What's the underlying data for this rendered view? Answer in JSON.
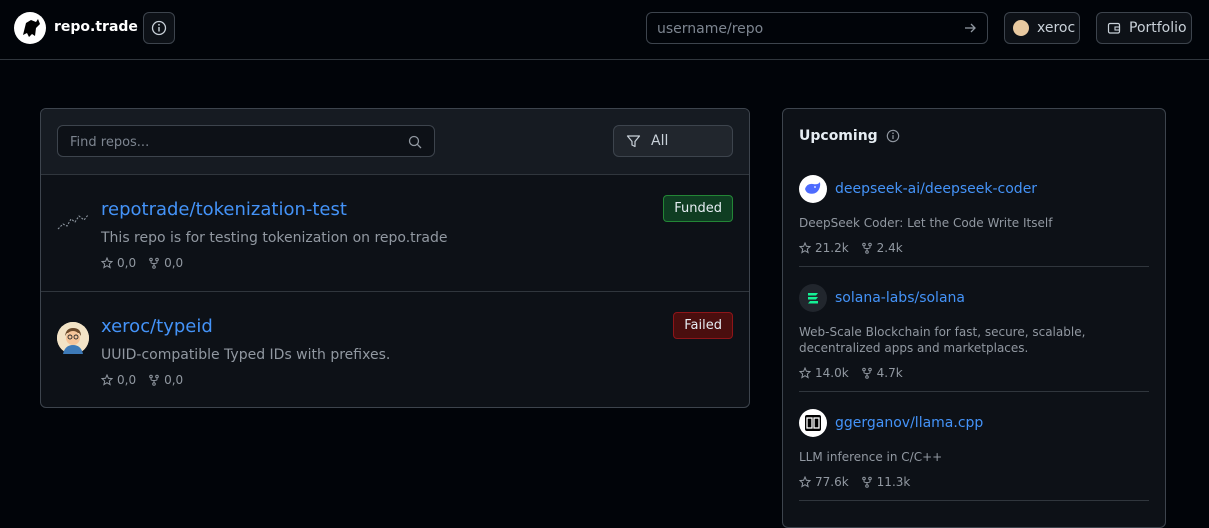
{
  "header": {
    "brand": "repo.trade",
    "search_placeholder": "username/repo",
    "user_label": "xeroc",
    "portfolio_label": "Portfolio"
  },
  "repos": {
    "search_placeholder": "Find repos...",
    "filter_label": "All",
    "items": [
      {
        "name": "repotrade/tokenization-test",
        "description": "This repo is for testing tokenization on repo.trade",
        "stars": "0,0",
        "forks": "0,0",
        "status": "Funded"
      },
      {
        "name": "xeroc/typeid",
        "description": "UUID-compatible Typed IDs with prefixes.",
        "stars": "0,0",
        "forks": "0,0",
        "status": "Failed"
      }
    ]
  },
  "upcoming": {
    "title": "Upcoming",
    "items": [
      {
        "name": "deepseek-ai/deepseek-coder",
        "description": "DeepSeek Coder: Let the Code Write Itself",
        "stars": "21.2k",
        "forks": "2.4k"
      },
      {
        "name": "solana-labs/solana",
        "description": "Web-Scale Blockchain for fast, secure, scalable, decentralized apps and marketplaces.",
        "stars": "14.0k",
        "forks": "4.7k"
      },
      {
        "name": "ggerganov/llama.cpp",
        "description": "LLM inference in C/C++",
        "stars": "77.6k",
        "forks": "11.3k"
      }
    ]
  },
  "colors": {
    "link": "#4493f8",
    "funded": "#238636",
    "failed": "#8e1519"
  }
}
